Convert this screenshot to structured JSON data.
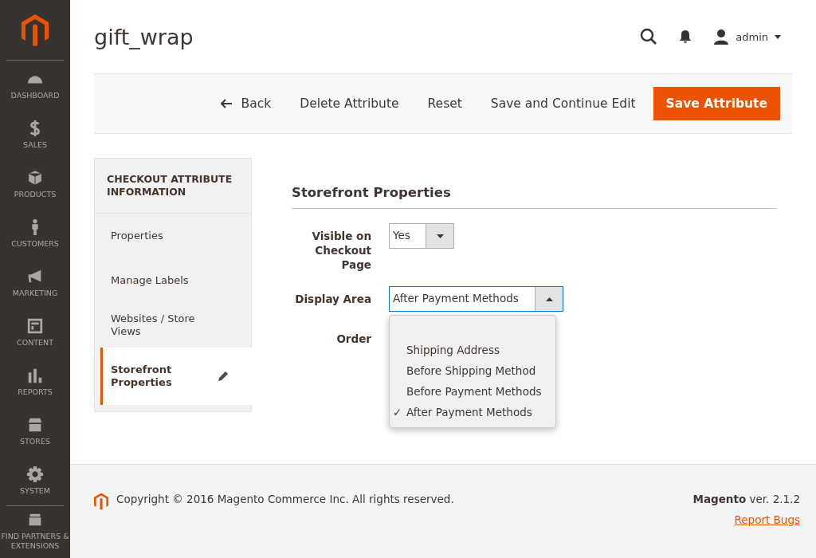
{
  "nav": [
    {
      "label": "DASHBOARD"
    },
    {
      "label": "SALES"
    },
    {
      "label": "PRODUCTS"
    },
    {
      "label": "CUSTOMERS"
    },
    {
      "label": "MARKETING"
    },
    {
      "label": "CONTENT"
    },
    {
      "label": "REPORTS"
    },
    {
      "label": "STORES"
    },
    {
      "label": "SYSTEM"
    },
    {
      "label": "FIND PARTNERS & EXTENSIONS"
    }
  ],
  "page_title": "gift_wrap",
  "user": "admin",
  "actions": [
    {
      "label": "Back",
      "kind": "back"
    },
    {
      "label": "Delete Attribute",
      "kind": "plain"
    },
    {
      "label": "Reset",
      "kind": "plain"
    },
    {
      "label": "Save and Continue Edit",
      "kind": "plain"
    },
    {
      "label": "Save Attribute",
      "kind": "primary"
    }
  ],
  "tabs_title": "CHECKOUT ATTRIBUTE INFORMATION",
  "tabs": [
    {
      "label": "Properties",
      "selected": false,
      "changed": false
    },
    {
      "label": "Manage Labels",
      "selected": false,
      "changed": false
    },
    {
      "label": "Websites / Store Views",
      "selected": false,
      "changed": false
    },
    {
      "label": "Storefront Properties",
      "selected": true,
      "changed": true
    }
  ],
  "section_title": "Storefront Properties",
  "fields": [
    {
      "label": "Visible on Checkout Page",
      "kind": "select",
      "value": "Yes",
      "open": false
    },
    {
      "label": "Display Area",
      "kind": "select",
      "value": "After Payment Methods",
      "open": true,
      "options": [
        {
          "label": "Shipping Address",
          "selected": false
        },
        {
          "label": "Before Shipping Method",
          "selected": false
        },
        {
          "label": "Before Payment Methods",
          "selected": false
        },
        {
          "label": "After Payment Methods",
          "selected": true
        }
      ]
    },
    {
      "label": "Order",
      "kind": "text"
    }
  ],
  "checkmark": "✓",
  "footer": {
    "copyright": "Copyright © 2016 Magento Commerce Inc. All rights reserved.",
    "version": "**Magento** ver. 2.1.2",
    "link": "Report Bugs"
  }
}
